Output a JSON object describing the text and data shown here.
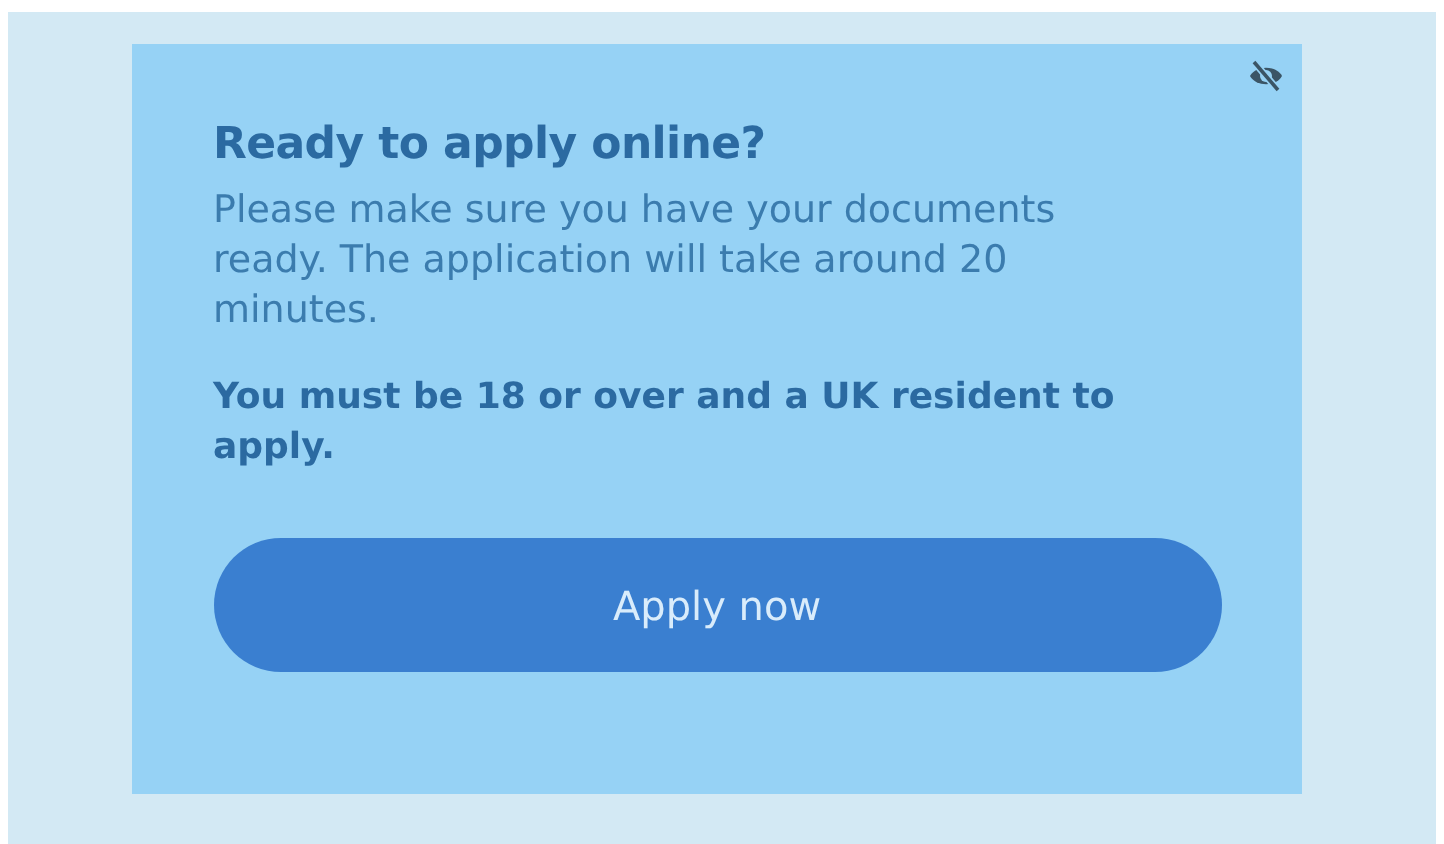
{
  "card": {
    "title": "Ready to apply online?",
    "description": "Please make sure you have your documents ready. The application will take around 20 minutes.",
    "requirement": "You must be 18 or over and a UK resident to apply.",
    "button": "Apply now"
  }
}
